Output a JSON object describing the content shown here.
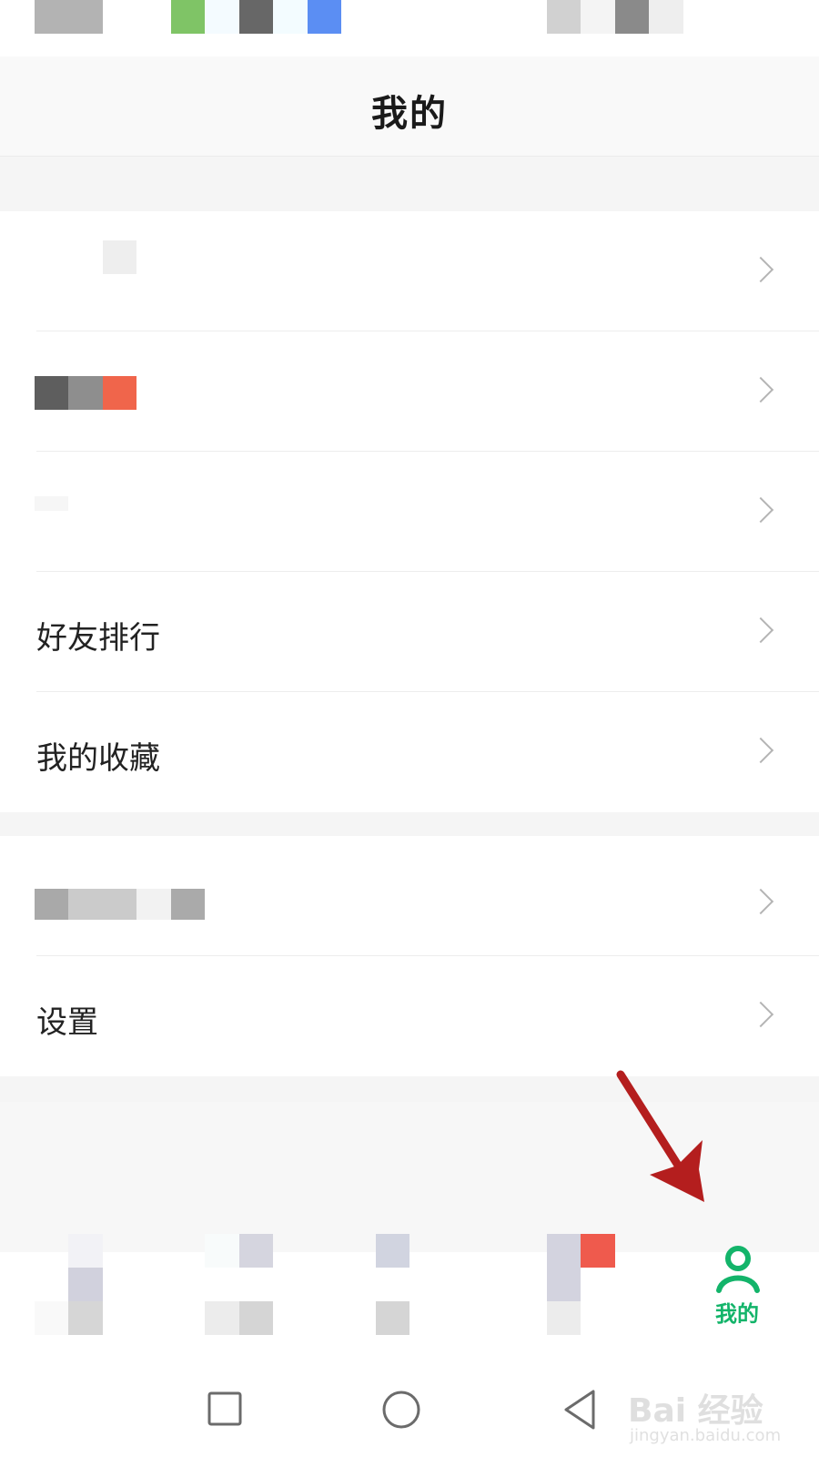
{
  "header": {
    "title": "我的"
  },
  "menu": {
    "items": [
      {
        "label": "",
        "obscured": true
      },
      {
        "label": "",
        "obscured": true
      },
      {
        "label": "",
        "obscured": true
      },
      {
        "label": "好友排行"
      },
      {
        "label": "我的收藏"
      },
      {
        "label": "",
        "obscured": true
      },
      {
        "label": "设置"
      }
    ]
  },
  "tabbar": {
    "active_label": "我的",
    "active_color": "#13b46a",
    "active_icon": "person-icon"
  },
  "navbar": {
    "icons": [
      "recent-apps-icon",
      "home-icon",
      "back-icon"
    ]
  },
  "watermark": {
    "brand": "Bai 经验",
    "url": "jingyan.baidu.com"
  },
  "annotation": {
    "arrow_color": "#b41e1e"
  }
}
